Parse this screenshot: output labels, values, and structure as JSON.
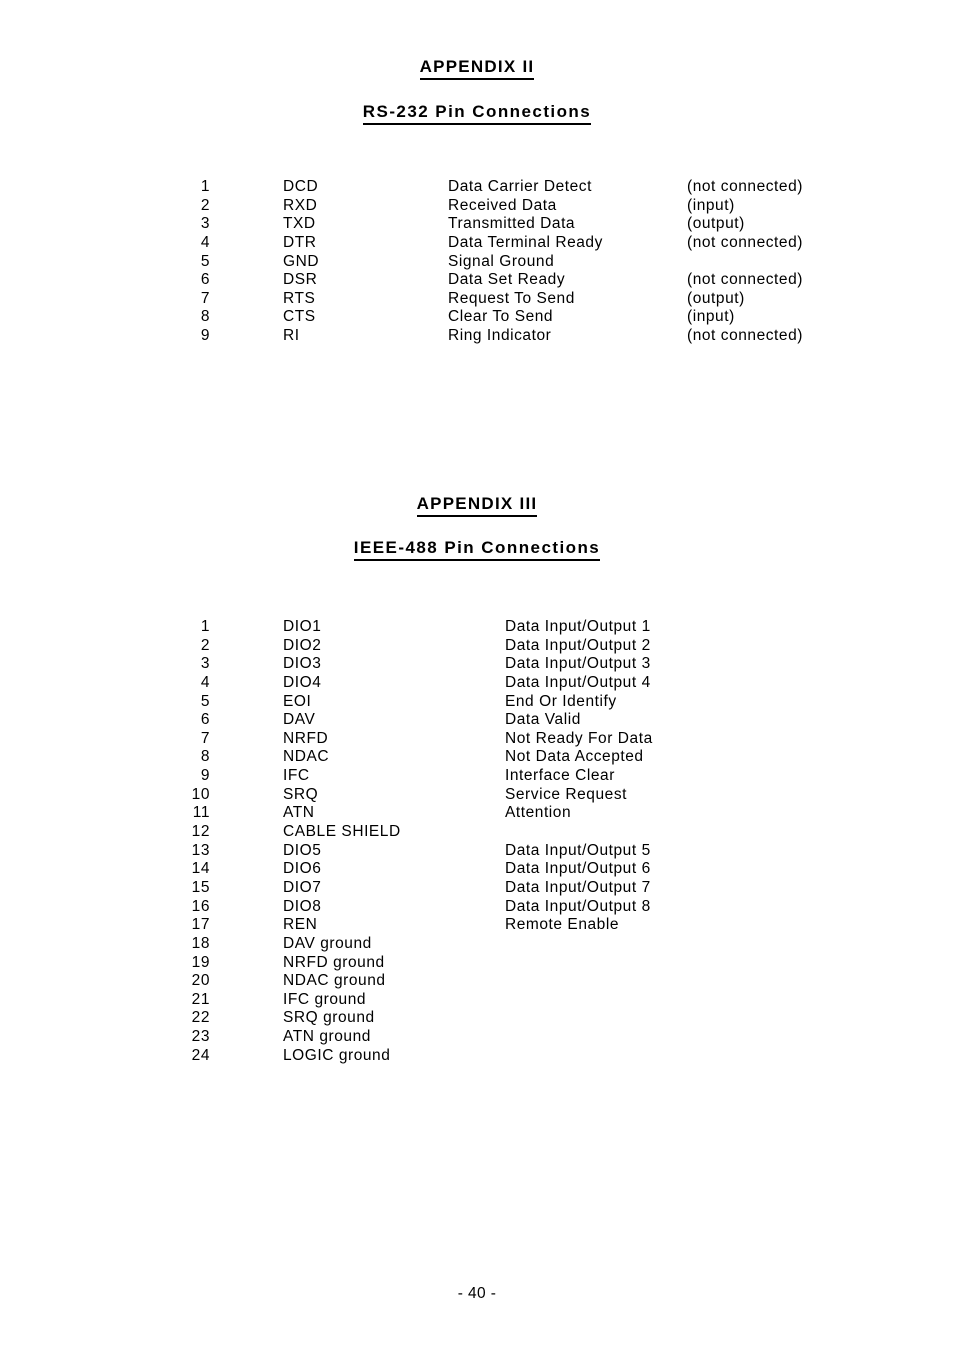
{
  "page": {
    "footer_label": "- 40 -",
    "background_color": "#ffffff",
    "text_color": "#000000"
  },
  "appendix_2": {
    "title": "APPENDIX II",
    "subtitle": "RS-232 Pin Connections",
    "rows": [
      {
        "pin": "1",
        "signal": "DCD",
        "description": "Data Carrier Detect",
        "note": "(not connected)"
      },
      {
        "pin": "2",
        "signal": "RXD",
        "description": "Received Data",
        "note": "(input)"
      },
      {
        "pin": "3",
        "signal": "TXD",
        "description": "Transmitted Data",
        "note": "(output)"
      },
      {
        "pin": "4",
        "signal": "DTR",
        "description": "Data Terminal Ready",
        "note": "(not connected)"
      },
      {
        "pin": "5",
        "signal": "GND",
        "description": "Signal Ground",
        "note": ""
      },
      {
        "pin": "6",
        "signal": "DSR",
        "description": "Data Set Ready",
        "note": "(not connected)"
      },
      {
        "pin": "7",
        "signal": "RTS",
        "description": "Request To Send",
        "note": "(output)"
      },
      {
        "pin": "8",
        "signal": "CTS",
        "description": "Clear To Send",
        "note": "(input)"
      },
      {
        "pin": "9",
        "signal": "RI",
        "description": "Ring Indicator",
        "note": "(not connected)"
      }
    ]
  },
  "appendix_3": {
    "title": "APPENDIX III",
    "subtitle": "IEEE-488 Pin Connections",
    "rows": [
      {
        "pin": "1",
        "signal": "DIO1",
        "description": "Data Input/Output 1"
      },
      {
        "pin": "2",
        "signal": "DIO2",
        "description": "Data Input/Output 2"
      },
      {
        "pin": "3",
        "signal": "DIO3",
        "description": "Data Input/Output 3"
      },
      {
        "pin": "4",
        "signal": "DIO4",
        "description": "Data Input/Output 4"
      },
      {
        "pin": "5",
        "signal": "EOI",
        "description": "End Or Identify"
      },
      {
        "pin": "6",
        "signal": "DAV",
        "description": "Data Valid"
      },
      {
        "pin": "7",
        "signal": "NRFD",
        "description": "Not Ready For Data"
      },
      {
        "pin": "8",
        "signal": "NDAC",
        "description": "Not Data Accepted"
      },
      {
        "pin": "9",
        "signal": "IFC",
        "description": "Interface Clear"
      },
      {
        "pin": "10",
        "signal": "SRQ",
        "description": "Service Request"
      },
      {
        "pin": "11",
        "signal": "ATN",
        "description": "Attention"
      },
      {
        "pin": "12",
        "signal": "CABLE SHIELD",
        "description": ""
      },
      {
        "pin": "13",
        "signal": "DIO5",
        "description": "Data Input/Output 5"
      },
      {
        "pin": "14",
        "signal": "DIO6",
        "description": "Data Input/Output 6"
      },
      {
        "pin": "15",
        "signal": "DIO7",
        "description": "Data Input/Output 7"
      },
      {
        "pin": "16",
        "signal": "DIO8",
        "description": "Data Input/Output 8"
      },
      {
        "pin": "17",
        "signal": "REN",
        "description": "Remote Enable"
      },
      {
        "pin": "18",
        "signal": "DAV ground",
        "description": ""
      },
      {
        "pin": "19",
        "signal": "NRFD ground",
        "description": ""
      },
      {
        "pin": "20",
        "signal": "NDAC ground",
        "description": ""
      },
      {
        "pin": "21",
        "signal": "IFC ground",
        "description": ""
      },
      {
        "pin": "22",
        "signal": "SRQ ground",
        "description": ""
      },
      {
        "pin": "23",
        "signal": "ATN ground",
        "description": ""
      },
      {
        "pin": "24",
        "signal": "LOGIC ground",
        "description": ""
      }
    ]
  }
}
